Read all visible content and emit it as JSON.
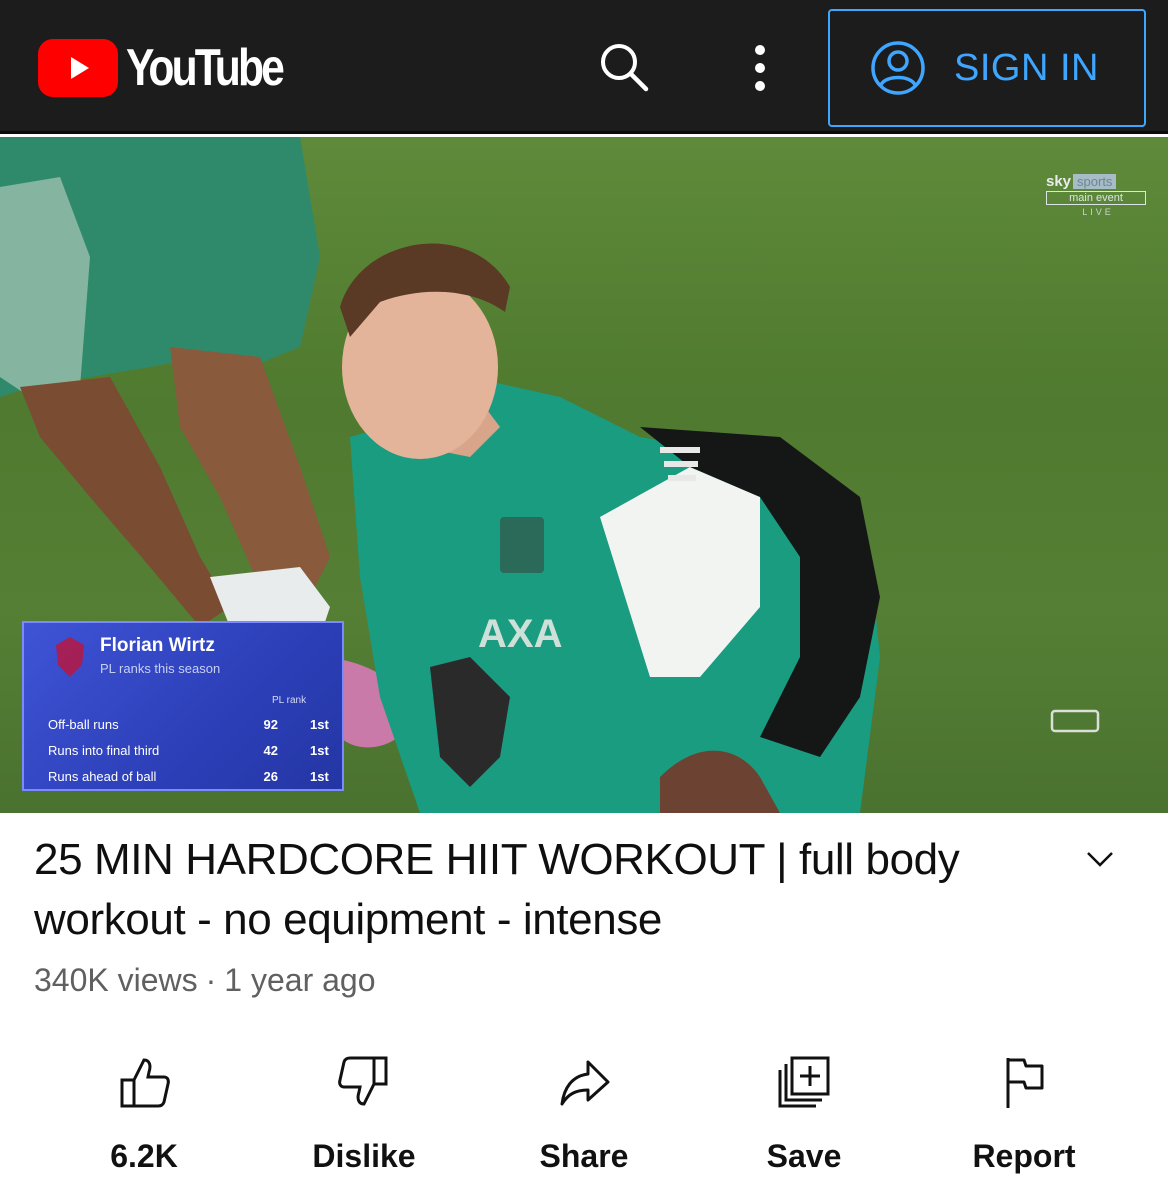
{
  "topbar": {
    "logo_text": "YouTube",
    "search_icon": "search-icon",
    "more_icon": "more-vertical-icon",
    "signin_label": "SIGN IN",
    "signin_icon": "account-circle-icon",
    "accent_color": "#3ea6ff",
    "brand_color": "#ff0000"
  },
  "video": {
    "broadcaster": {
      "brand": "sky",
      "channel": "sports",
      "event": "main event",
      "live": "LIVE"
    },
    "stats_card": {
      "player": "Florian Wirtz",
      "subtitle": "PL ranks this season",
      "rank_header": "PL rank",
      "rows": [
        {
          "label": "Off-ball runs",
          "value": "92",
          "rank": "1st"
        },
        {
          "label": "Runs into final third",
          "value": "42",
          "rank": "1st"
        },
        {
          "label": "Runs ahead of ball",
          "value": "26",
          "rank": "1st"
        }
      ]
    }
  },
  "metadata": {
    "title": "25 MIN HARDCORE HIIT WORKOUT | full body workout - no equipment - intense",
    "views": "340K views",
    "separator": "·",
    "age": "1 year ago"
  },
  "actions": [
    {
      "label": "6.2K",
      "icon": "thumbs-up-icon"
    },
    {
      "label": "Dislike",
      "icon": "thumbs-down-icon"
    },
    {
      "label": "Share",
      "icon": "share-icon"
    },
    {
      "label": "Save",
      "icon": "add-to-playlist-icon"
    },
    {
      "label": "Report",
      "icon": "flag-icon"
    }
  ]
}
